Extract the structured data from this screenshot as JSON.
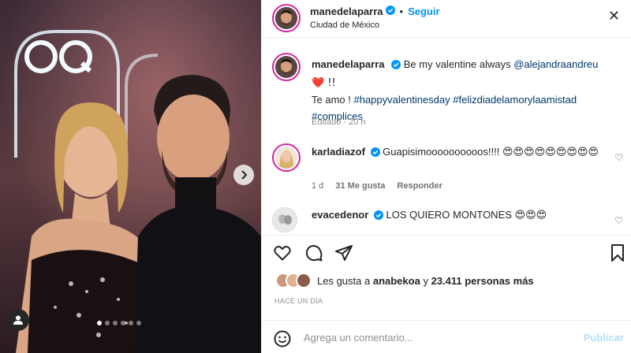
{
  "photo": {
    "brand_sign": "GQ",
    "carousel_dots": 6,
    "active_dot": 0
  },
  "header": {
    "username": "manedelaparra",
    "separator": "•",
    "follow_label": "Seguir",
    "location": "Ciudad de México",
    "close_symbol": "✕"
  },
  "caption": {
    "username": "manedelaparra",
    "text1": "Be my valentine always",
    "mention": "@alejandraandreu",
    "heart": "❤️ !!",
    "text2": "Te amo !",
    "hashtag1": "#happyvalentinesday",
    "hashtag2": "#felizdiadelamorylaamistad",
    "hashtag3": "#complices",
    "meta": "Editado · 20 h"
  },
  "comments": [
    {
      "username": "karladiazof",
      "text": "Guapisimoooooooooos!!!!",
      "emojis": "😍😍😍😍😍😍😍😍😍",
      "age": "1 d",
      "likes": "31 Me gusta",
      "reply": "Responder"
    },
    {
      "username": "evacedenor",
      "text": "LOS QUIERO MONTONES",
      "emojis": "😍😍😍"
    }
  ],
  "likes": {
    "prefix": "Les gusta a",
    "user": "anabekoa",
    "middle": "y",
    "count": "23.411 personas más"
  },
  "date": "HACE UN DÍA",
  "comment_box": {
    "placeholder": "Agrega un comentario...",
    "post_label": "Publicar"
  },
  "colors": {
    "accent": "#0095f6",
    "link": "#00376b",
    "muted": "#8e8e8e",
    "post_disabled": "#b2dffc"
  },
  "icons": [
    "heart-icon",
    "comment-icon",
    "share-icon",
    "bookmark-icon",
    "emoji-icon",
    "verified-icon",
    "chevron-right-icon",
    "user-tag-icon",
    "close-icon"
  ]
}
